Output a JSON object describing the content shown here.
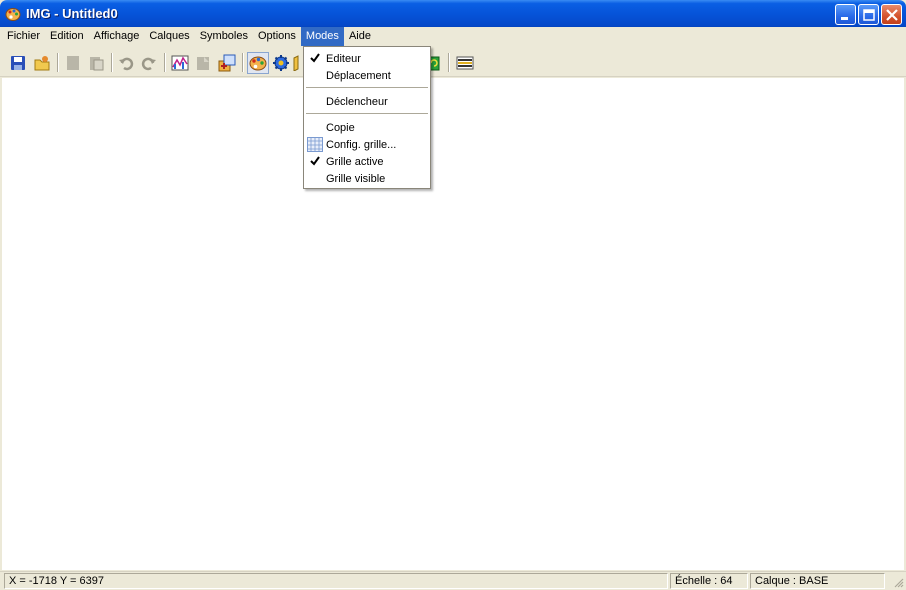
{
  "window": {
    "title": "IMG - Untitled0"
  },
  "menubar": {
    "items": [
      {
        "label": "Fichier"
      },
      {
        "label": "Edition"
      },
      {
        "label": "Affichage"
      },
      {
        "label": "Calques"
      },
      {
        "label": "Symboles"
      },
      {
        "label": "Options"
      },
      {
        "label": "Modes",
        "open": true
      },
      {
        "label": "Aide"
      }
    ]
  },
  "modes_menu": {
    "items": [
      {
        "label": "Editeur",
        "checked": true
      },
      {
        "label": "Déplacement",
        "checked": false
      },
      {
        "label": "Déclencheur",
        "checked": false
      },
      {
        "label": "Copie",
        "checked": false
      },
      {
        "label": "Config. grille...",
        "checked": false,
        "icon": "grid-icon"
      },
      {
        "label": "Grille active",
        "checked": true
      },
      {
        "label": "Grille visible",
        "checked": false
      }
    ]
  },
  "toolbar": {
    "icons": [
      "save-icon",
      "open-icon",
      "cut-icon",
      "paste-icon",
      "undo-icon",
      "redo-icon",
      "chart-icon",
      "blank-icon",
      "import-icon",
      "palette-icon",
      "gear-icon",
      "map-icon",
      "layers-icon"
    ]
  },
  "statusbar": {
    "coords": "X = -1718  Y = 6397",
    "scale": "Échelle :  64",
    "layer": "Calque :  BASE"
  },
  "colors": {
    "titlebar": "#0653d8",
    "menu_highlight": "#316ac5",
    "chrome": "#ece9d8"
  }
}
